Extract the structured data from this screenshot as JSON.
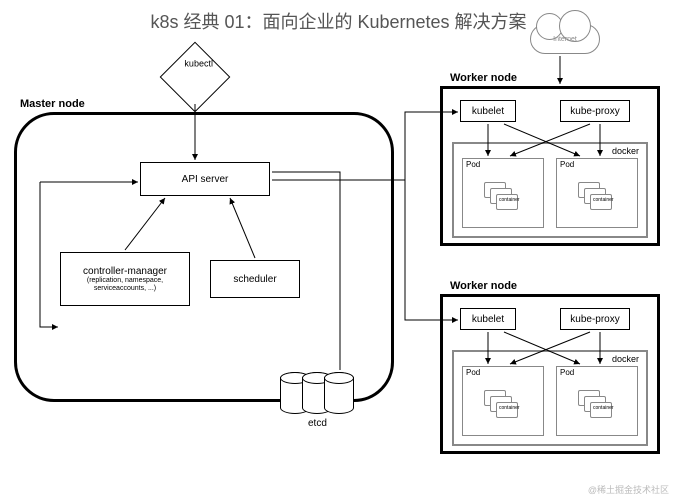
{
  "title": "k8s 经典 01：面向企业的 Kubernetes 解决方案",
  "cloud": "Internet",
  "kubectl": "kubectl",
  "master": {
    "label": "Master node",
    "api": "API server",
    "cm": "controller-manager",
    "cm_sub": "(replication, namespace, serviceaccounts, ...)",
    "scheduler": "scheduler",
    "etcd": "etcd"
  },
  "worker": {
    "label": "Worker node",
    "kubelet": "kubelet",
    "kubeproxy": "kube-proxy",
    "docker": "docker",
    "pod": "Pod",
    "container": "container"
  },
  "watermark": "@稀土掘金技术社区"
}
